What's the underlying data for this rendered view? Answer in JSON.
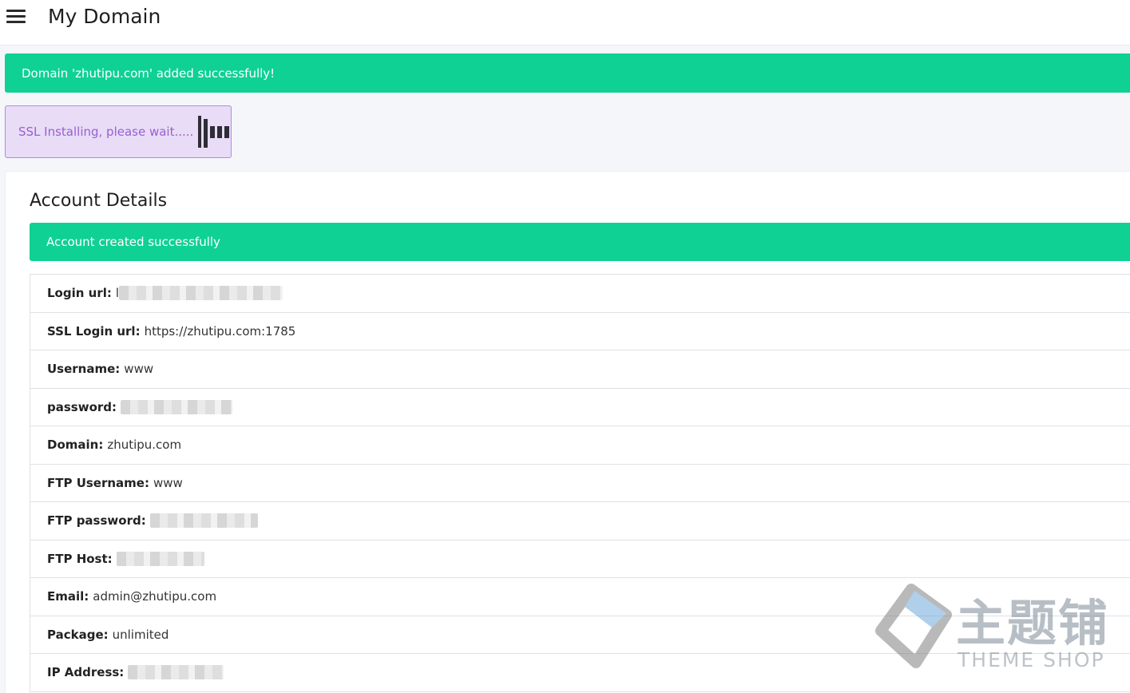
{
  "header": {
    "title": "My Domain",
    "menu_icon": "hamburger-menu-icon"
  },
  "alerts": {
    "domain_added": "Domain 'zhutipu.com' added successfully!"
  },
  "ssl_status": {
    "text": "SSL Installing, please wait.....",
    "icon": "loading-spinner-icon"
  },
  "account": {
    "title": "Account Details",
    "success_message": "Account created successfully",
    "rows": [
      {
        "label": "Login url:",
        "value": "l",
        "redacted": true
      },
      {
        "label": "SSL Login url:",
        "value": "https://zhutipu.com:1785",
        "redacted": false
      },
      {
        "label": "Username:",
        "value": "www",
        "redacted": false
      },
      {
        "label": "password:",
        "value": "",
        "redacted": true
      },
      {
        "label": "Domain:",
        "value": "zhutipu.com",
        "redacted": false
      },
      {
        "label": "FTP Username:",
        "value": "www",
        "redacted": false
      },
      {
        "label": "FTP password:",
        "value": "",
        "redacted": true
      },
      {
        "label": "FTP Host:",
        "value": "",
        "redacted": true
      },
      {
        "label": "Email:",
        "value": "admin@zhutipu.com",
        "redacted": false
      },
      {
        "label": "Package:",
        "value": "unlimited",
        "redacted": false
      },
      {
        "label": "IP Address:",
        "value": "",
        "redacted": true
      }
    ]
  },
  "watermark": {
    "text_cn": "主题铺",
    "text_en": "THEME SHOP",
    "icon": "zhutipu-logo-icon"
  },
  "colors": {
    "success": "#0fd193",
    "ssl_bg": "#e8dcf7",
    "ssl_text": "#9a60cf",
    "page_bg": "#f5f6fa"
  }
}
